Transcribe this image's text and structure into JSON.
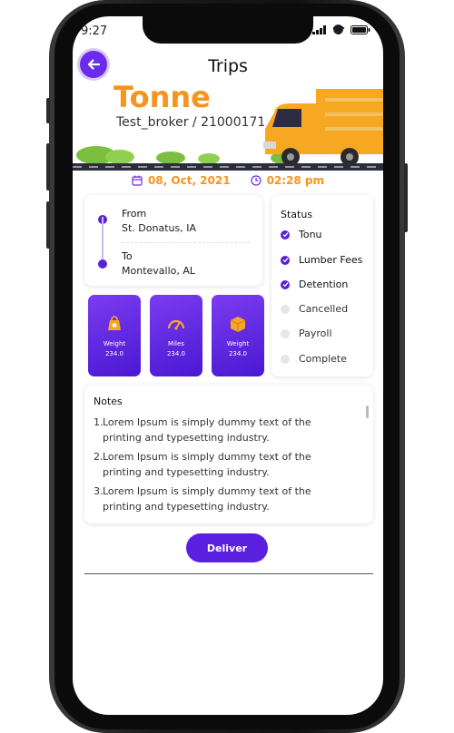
{
  "status_bar": {
    "time": "9:27"
  },
  "header": {
    "title": "Trips",
    "brand": "Tonne",
    "broker": "Test_broker / 21000171"
  },
  "trip": {
    "date": "08, Oct, 2021",
    "time": "02:28 pm"
  },
  "route": {
    "from_label": "From",
    "from_value": "St. Donatus, IA",
    "to_label": "To",
    "to_value": "Montevallo, AL"
  },
  "metrics": [
    {
      "label": "Weight",
      "value": "234.0",
      "icon": "weight-icon"
    },
    {
      "label": "Miles",
      "value": "234.0",
      "icon": "speedometer-icon"
    },
    {
      "label": "Weight",
      "value": "234.0",
      "icon": "package-icon"
    }
  ],
  "status": {
    "title": "Status",
    "items": [
      {
        "label": "Tonu",
        "done": true
      },
      {
        "label": "Lumber Fees",
        "done": true
      },
      {
        "label": "Detention",
        "done": true
      },
      {
        "label": "Cancelled",
        "done": false
      },
      {
        "label": "Payroll",
        "done": false
      },
      {
        "label": "Complete",
        "done": false
      }
    ]
  },
  "notes": {
    "title": "Notes",
    "items": [
      {
        "num": "1.",
        "text": "Lorem Ipsum is simply dummy text of the printing and typesetting industry."
      },
      {
        "num": "2.",
        "text": "Lorem Ipsum is simply dummy text of the printing and typesetting industry."
      },
      {
        "num": "3.",
        "text": "Lorem Ipsum is simply dummy text of the printing and typesetting industry."
      }
    ]
  },
  "actions": {
    "deliver_label": "Deliver"
  },
  "colors": {
    "accent": "#5b1fe0",
    "brand": "#f7941d",
    "done": "#5b21d6",
    "pending": "#e6e6e6"
  }
}
